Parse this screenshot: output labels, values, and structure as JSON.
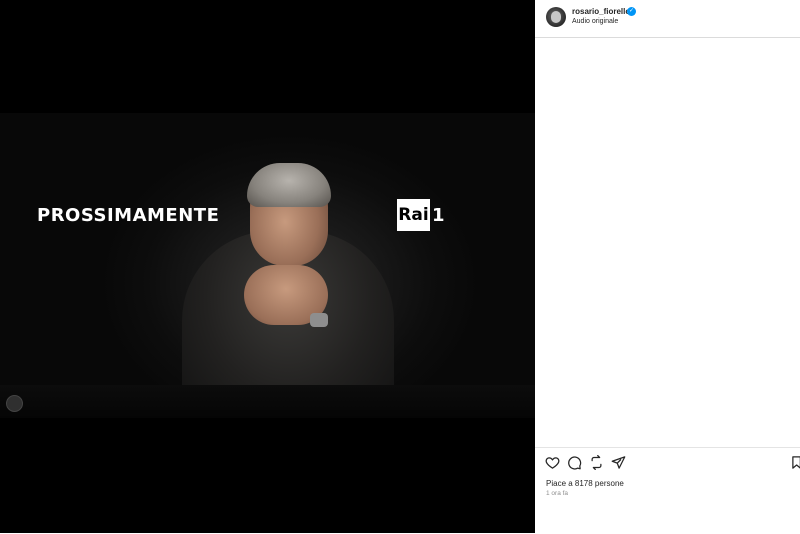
{
  "post": {
    "overlay_text": "PROSSIMAMENTE",
    "channel_logo": {
      "box_text": "Rai",
      "number": "1"
    }
  },
  "header": {
    "username": "rosario_fiorello",
    "verified_icon": "verified-badge-icon",
    "audio_label": "Audio originale"
  },
  "actions": {
    "icons": [
      "heart-icon",
      "comment-icon",
      "share-icon",
      "send-icon",
      "bookmark-icon"
    ],
    "likes_text": "Piace a 8178 persone",
    "timestamp": "1 ora fa"
  },
  "colors": {
    "verified": "#0095f6",
    "media_bg": "#000000",
    "text": "#262626",
    "muted": "#8e8e8e"
  }
}
